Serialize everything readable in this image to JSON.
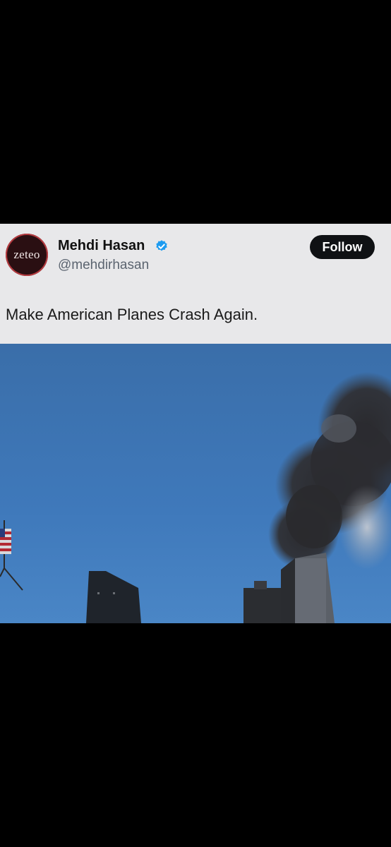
{
  "tweet": {
    "avatar_text": "zeteo",
    "author_name": "Mehdi Hasan",
    "author_handle": "@mehdirhasan",
    "verified_icon": "verified-badge-icon",
    "follow_label": "Follow",
    "text": "Make American Planes Crash Again."
  },
  "colors": {
    "sky": "#3d74b4",
    "follow_bg": "#0f1114",
    "verified_blue": "#1d9bf0"
  }
}
